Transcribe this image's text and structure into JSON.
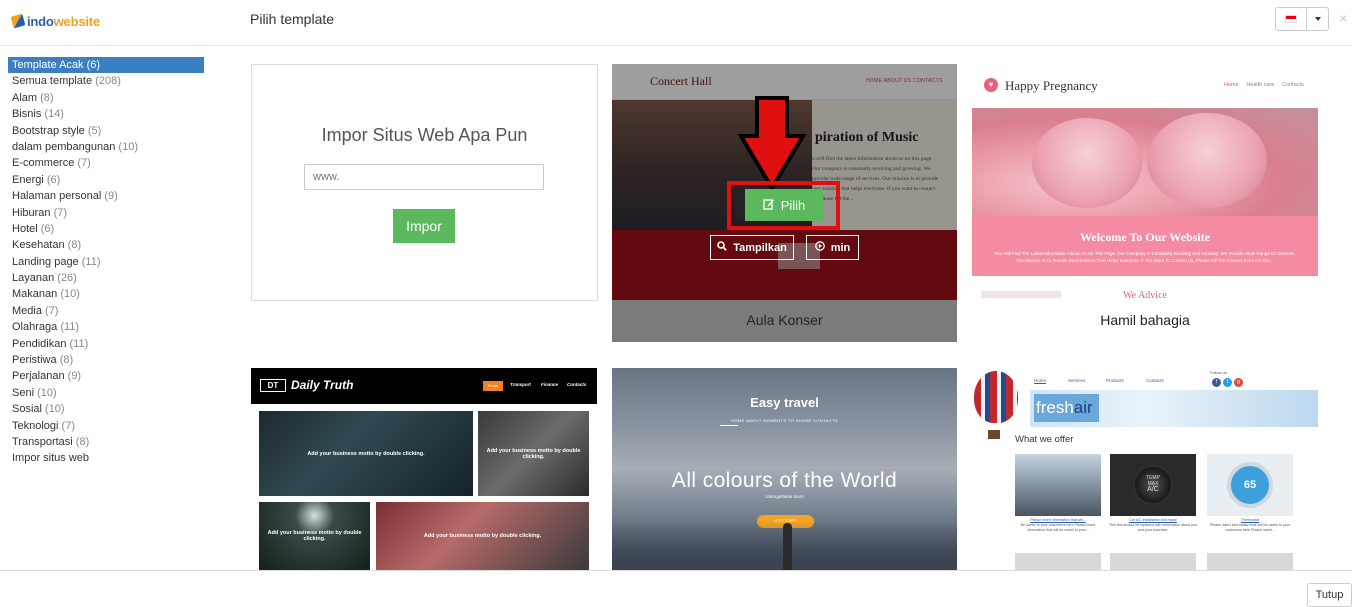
{
  "header": {
    "logo_part1": "indo",
    "logo_part2": "website",
    "title": "Pilih template",
    "close_glyph": "×"
  },
  "sidebar": {
    "items": [
      {
        "label": "Template Acak",
        "count": "(6)",
        "active": true
      },
      {
        "label": "Semua template",
        "count": "(208)"
      },
      {
        "label": "Alam",
        "count": "(8)"
      },
      {
        "label": "Bisnis",
        "count": "(14)"
      },
      {
        "label": "Bootstrap style",
        "count": "(5)"
      },
      {
        "label": "dalam pembangunan",
        "count": "(10)"
      },
      {
        "label": "E-commerce",
        "count": "(7)"
      },
      {
        "label": "Energi",
        "count": "(6)"
      },
      {
        "label": "Halaman personal",
        "count": "(9)"
      },
      {
        "label": "Hiburan",
        "count": "(7)"
      },
      {
        "label": "Hotel",
        "count": "(6)"
      },
      {
        "label": "Kesehatan",
        "count": "(8)"
      },
      {
        "label": "Landing page",
        "count": "(11)"
      },
      {
        "label": "Layanan",
        "count": "(26)"
      },
      {
        "label": "Makanan",
        "count": "(10)"
      },
      {
        "label": "Media",
        "count": "(7)"
      },
      {
        "label": "Olahraga",
        "count": "(11)"
      },
      {
        "label": "Pendidikan",
        "count": "(11)"
      },
      {
        "label": "Peristiwa",
        "count": "(8)"
      },
      {
        "label": "Perjalanan",
        "count": "(9)"
      },
      {
        "label": "Seni",
        "count": "(10)"
      },
      {
        "label": "Sosial",
        "count": "(10)"
      },
      {
        "label": "Teknologi",
        "count": "(7)"
      },
      {
        "label": "Transportasi",
        "count": "(8)"
      },
      {
        "label": "Impor situs web",
        "count": ""
      }
    ]
  },
  "import_card": {
    "title": "Impor Situs Web Apa Pun",
    "input_placeholder": "www.",
    "button_label": "Impor"
  },
  "concert": {
    "brand": "Concert Hall",
    "nav": "HOME    ABOUT US    CONTACTS",
    "hero_heading": "piration of Music",
    "hero_text": "u will find the latest information about us on this page. Our company is constantly evolving and growing. We provide wide range of services. Our mission is to provide best solution that helps everyone. If you want to contact us, please fill the...",
    "pilih_label": "Pilih",
    "tampilkan_label": "Tampilkan",
    "min_label": "min",
    "caption": "Aula Konser"
  },
  "pregnancy": {
    "brand": "Happy Pregnancy",
    "nav_home": "Home",
    "nav_health": "Health care",
    "nav_contacts": "Contacts",
    "welcome": "Welcome To Our Website",
    "welcome_text": "You Will Find The Latest Information About Us On This Page. Our Company Is Constantly Evolving And Growing. We Provide Wide Range Of Services. Our Mission Is To Provide Best Solution That Helps Everyone. If You Want To Contact Us, Please Fill The Contact Form On Our...",
    "advice": "We Advice",
    "caption": "Hamil bahagia"
  },
  "truth": {
    "logo": "DT",
    "brand": "Daily Truth",
    "nav_home": "Home",
    "nav_transport": "Transport",
    "nav_finance": "Finance",
    "nav_contacts": "Contacts",
    "tile_text": "Add your business motto by double clicking."
  },
  "travel": {
    "brand": "Easy travel",
    "nav": "HOME      ABOUT      MOMENTS TO SHARE      CONTACTS",
    "headline": "All colours of the World",
    "sub": "Unforgettable tours",
    "cta": "LET'S START!"
  },
  "fresh": {
    "nav_home": "Home",
    "nav_services": "Services",
    "nav_products": "Products",
    "nav_contacts": "Contacts",
    "follow": "Follow us",
    "logo_a": "fresh",
    "logo_b": "air",
    "offer": "What we offer",
    "cap1_link": "Please insert information that will...",
    "cap1_text": "Be useful to your customers here Please insert information that will be useful to your...",
    "cap2_link": "Car A/C installation and repair",
    "cap2_text": "This text should be replaced with information about you and your business.",
    "cap3_link": "Thermostat",
    "cap3_text": "Please insert information that will be useful to your customers here Please insert...",
    "gauge": "65",
    "ac_small": "TEMP",
    "ac_big": "A/C",
    "ac_sub": "MAX"
  },
  "footer": {
    "close_label": "Tutup"
  },
  "colors": {
    "active_item": "#3c7fc1",
    "green_button": "#5cb85c",
    "highlight_red": "#e01010"
  }
}
